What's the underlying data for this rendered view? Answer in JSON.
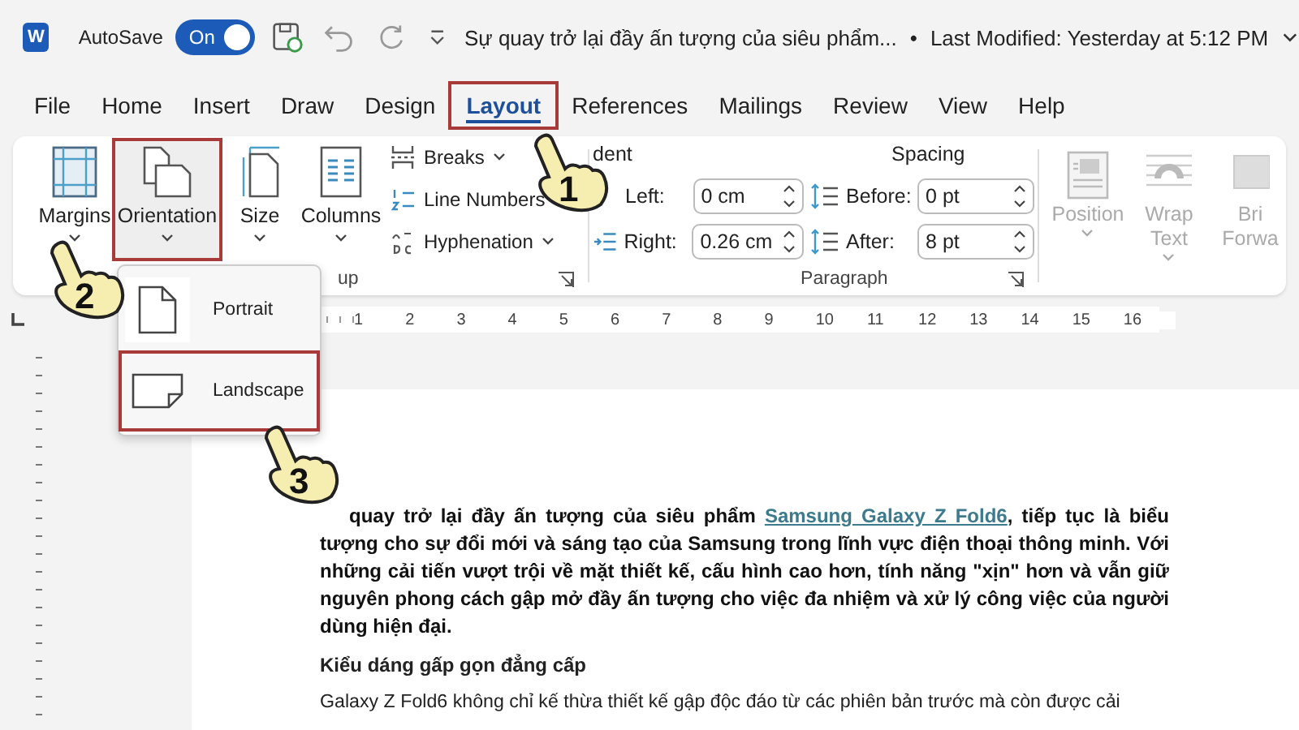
{
  "title_bar": {
    "logo": "W",
    "autosave_label": "AutoSave",
    "autosave_toggle": {
      "label": "On",
      "on": true
    },
    "document_title": "Sự quay trở lại đầy ấn tượng của siêu phẩm...",
    "separator": "•",
    "last_modified": "Last Modified: Yesterday at 5:12 PM"
  },
  "tabs": [
    {
      "label": "File",
      "selected": false,
      "highlighted": false
    },
    {
      "label": "Home",
      "selected": false,
      "highlighted": false
    },
    {
      "label": "Insert",
      "selected": false,
      "highlighted": false
    },
    {
      "label": "Draw",
      "selected": false,
      "highlighted": false
    },
    {
      "label": "Design",
      "selected": false,
      "highlighted": false
    },
    {
      "label": "Layout",
      "selected": true,
      "highlighted": true
    },
    {
      "label": "References",
      "selected": false,
      "highlighted": false
    },
    {
      "label": "Mailings",
      "selected": false,
      "highlighted": false
    },
    {
      "label": "Review",
      "selected": false,
      "highlighted": false
    },
    {
      "label": "View",
      "selected": false,
      "highlighted": false
    },
    {
      "label": "Help",
      "selected": false,
      "highlighted": false
    }
  ],
  "ribbon": {
    "page_setup": {
      "large_buttons": [
        {
          "label": "Margins",
          "kind": "margins",
          "highlighted": false
        },
        {
          "label": "Orientation",
          "kind": "orientation",
          "highlighted": true
        },
        {
          "label": "Size",
          "kind": "size",
          "highlighted": false
        },
        {
          "label": "Columns",
          "kind": "columns",
          "highlighted": false
        }
      ],
      "small_buttons": [
        {
          "label": "Breaks",
          "kind": "breaks"
        },
        {
          "label": "Line Numbers",
          "kind": "line_numbers"
        },
        {
          "label": "Hyphenation",
          "kind": "hyphenation"
        }
      ],
      "group_label": "up"
    },
    "paragraph": {
      "indent_heading": "dent",
      "spacing_heading": "Spacing",
      "indent": [
        {
          "label": "Left:",
          "value": "0 cm"
        },
        {
          "label": "Right:",
          "value": "0.26 cm"
        }
      ],
      "spacing": [
        {
          "label": "Before:",
          "value": "0 pt"
        },
        {
          "label": "After:",
          "value": "8 pt"
        }
      ],
      "group_label": "Paragraph"
    },
    "arrange": [
      {
        "lines": [
          "Position"
        ],
        "kind": "position",
        "disabled": true
      },
      {
        "lines": [
          "Wrap",
          "Text"
        ],
        "kind": "wrap",
        "disabled": true
      },
      {
        "lines": [
          "Bri",
          "Forwa"
        ],
        "kind": "bring",
        "disabled": true
      }
    ]
  },
  "orientation_menu": [
    {
      "label": "Portrait",
      "kind": "portrait",
      "highlighted": false
    },
    {
      "label": "Landscape",
      "kind": "landscape",
      "highlighted": true
    }
  ],
  "ruler": {
    "numbers": [
      "1",
      "2",
      "3",
      "4",
      "5",
      "6",
      "7",
      "8",
      "9",
      "10",
      "11",
      "12",
      "13",
      "14",
      "15",
      "16"
    ]
  },
  "document": {
    "intro": {
      "before": "quay trở lại đầy ấn tượng của siêu phẩm ",
      "link": "Samsung Galaxy Z Fold6",
      "after": ", tiếp tục là biểu tượng cho sự đổi mới và sáng tạo của Samsung trong lĩnh vực điện thoại thông minh. Với những cải tiến vượt trội về mặt thiết kế, cấu hình cao hơn, tính năng \"xịn\" hơn và vẫn giữ nguyên phong cách gập mở đầy ấn tượng cho việc đa nhiệm và xử lý công việc của người dùng hiện đại."
    },
    "heading": "Kiểu dáng gấp gọn đẳng cấp",
    "paragraph": "Galaxy Z Fold6 không chỉ kế thừa thiết kế gập độc đáo từ các phiên bản trước mà còn được cải"
  },
  "callouts": [
    {
      "number": "1"
    },
    {
      "number": "2"
    },
    {
      "number": "3"
    }
  ]
}
